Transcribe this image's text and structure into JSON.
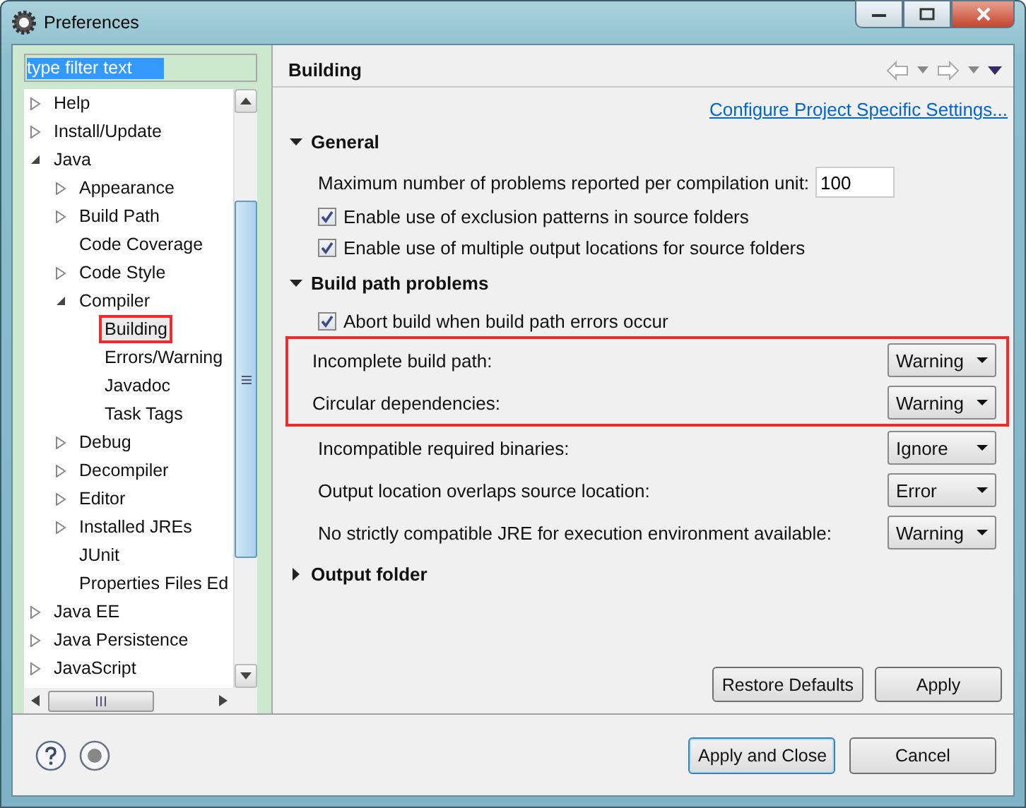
{
  "window": {
    "title": "Preferences"
  },
  "filter": {
    "value": "type filter text",
    "selected": true
  },
  "tree": [
    {
      "label": "Help",
      "expanded": false
    },
    {
      "label": "Install/Update",
      "expanded": false
    },
    {
      "label": "Java",
      "expanded": true,
      "children": [
        {
          "label": "Appearance",
          "expanded": false
        },
        {
          "label": "Build Path",
          "expanded": false
        },
        {
          "label": "Code Coverage"
        },
        {
          "label": "Code Style",
          "expanded": false
        },
        {
          "label": "Compiler",
          "expanded": true,
          "children": [
            {
              "label": "Building",
              "selected": true,
              "marked": true
            },
            {
              "label": "Errors/Warning",
              "selected": false,
              "marked": false
            },
            {
              "label": "Javadoc",
              "selected": false,
              "marked": false
            },
            {
              "label": "Task Tags",
              "selected": false,
              "marked": false
            }
          ]
        },
        {
          "label": "Debug",
          "expanded": false
        },
        {
          "label": "Decompiler",
          "expanded": false
        },
        {
          "label": "Editor",
          "expanded": false
        },
        {
          "label": "Installed JREs",
          "expanded": false
        },
        {
          "label": "JUnit"
        },
        {
          "label": "Properties Files Ed"
        }
      ]
    },
    {
      "label": "Java EE",
      "expanded": false
    },
    {
      "label": "Java Persistence",
      "expanded": false
    },
    {
      "label": "JavaScript",
      "expanded": false
    }
  ],
  "page": {
    "title": "Building",
    "link": "Configure Project Specific Settings...",
    "sections": [
      {
        "title": "General",
        "expanded": true,
        "settings": [
          {
            "kind": "number",
            "label": "Maximum number of problems reported per compilation unit:",
            "value": "100"
          },
          {
            "kind": "checkbox",
            "label": "Enable use of exclusion patterns in source folders",
            "checked": true
          },
          {
            "kind": "checkbox",
            "label": "Enable use of multiple output locations for source folders",
            "checked": true
          }
        ]
      },
      {
        "title": "Build path problems",
        "expanded": true,
        "settings": [
          {
            "kind": "checkbox",
            "label": "Abort build when build path errors occur",
            "checked": true
          },
          {
            "kind": "select",
            "label": "Incomplete build path:",
            "value": "Warning",
            "marked": true
          },
          {
            "kind": "select",
            "label": "Circular dependencies:",
            "value": "Warning",
            "marked": true
          },
          {
            "kind": "select",
            "label": "Incompatible required binaries:",
            "value": "Ignore",
            "marked": false
          },
          {
            "kind": "select",
            "label": "Output location overlaps source location:",
            "value": "Error",
            "marked": false
          },
          {
            "kind": "select",
            "label": "No strictly compatible JRE for execution environment available:",
            "value": "Warning",
            "marked": false
          }
        ]
      },
      {
        "title": "Output folder",
        "expanded": false
      }
    ],
    "buttons": [
      "Restore Defaults",
      "Apply"
    ]
  },
  "dialog_buttons": [
    {
      "label": "Apply and Close",
      "default": true
    },
    {
      "label": "Cancel",
      "default": false
    }
  ]
}
